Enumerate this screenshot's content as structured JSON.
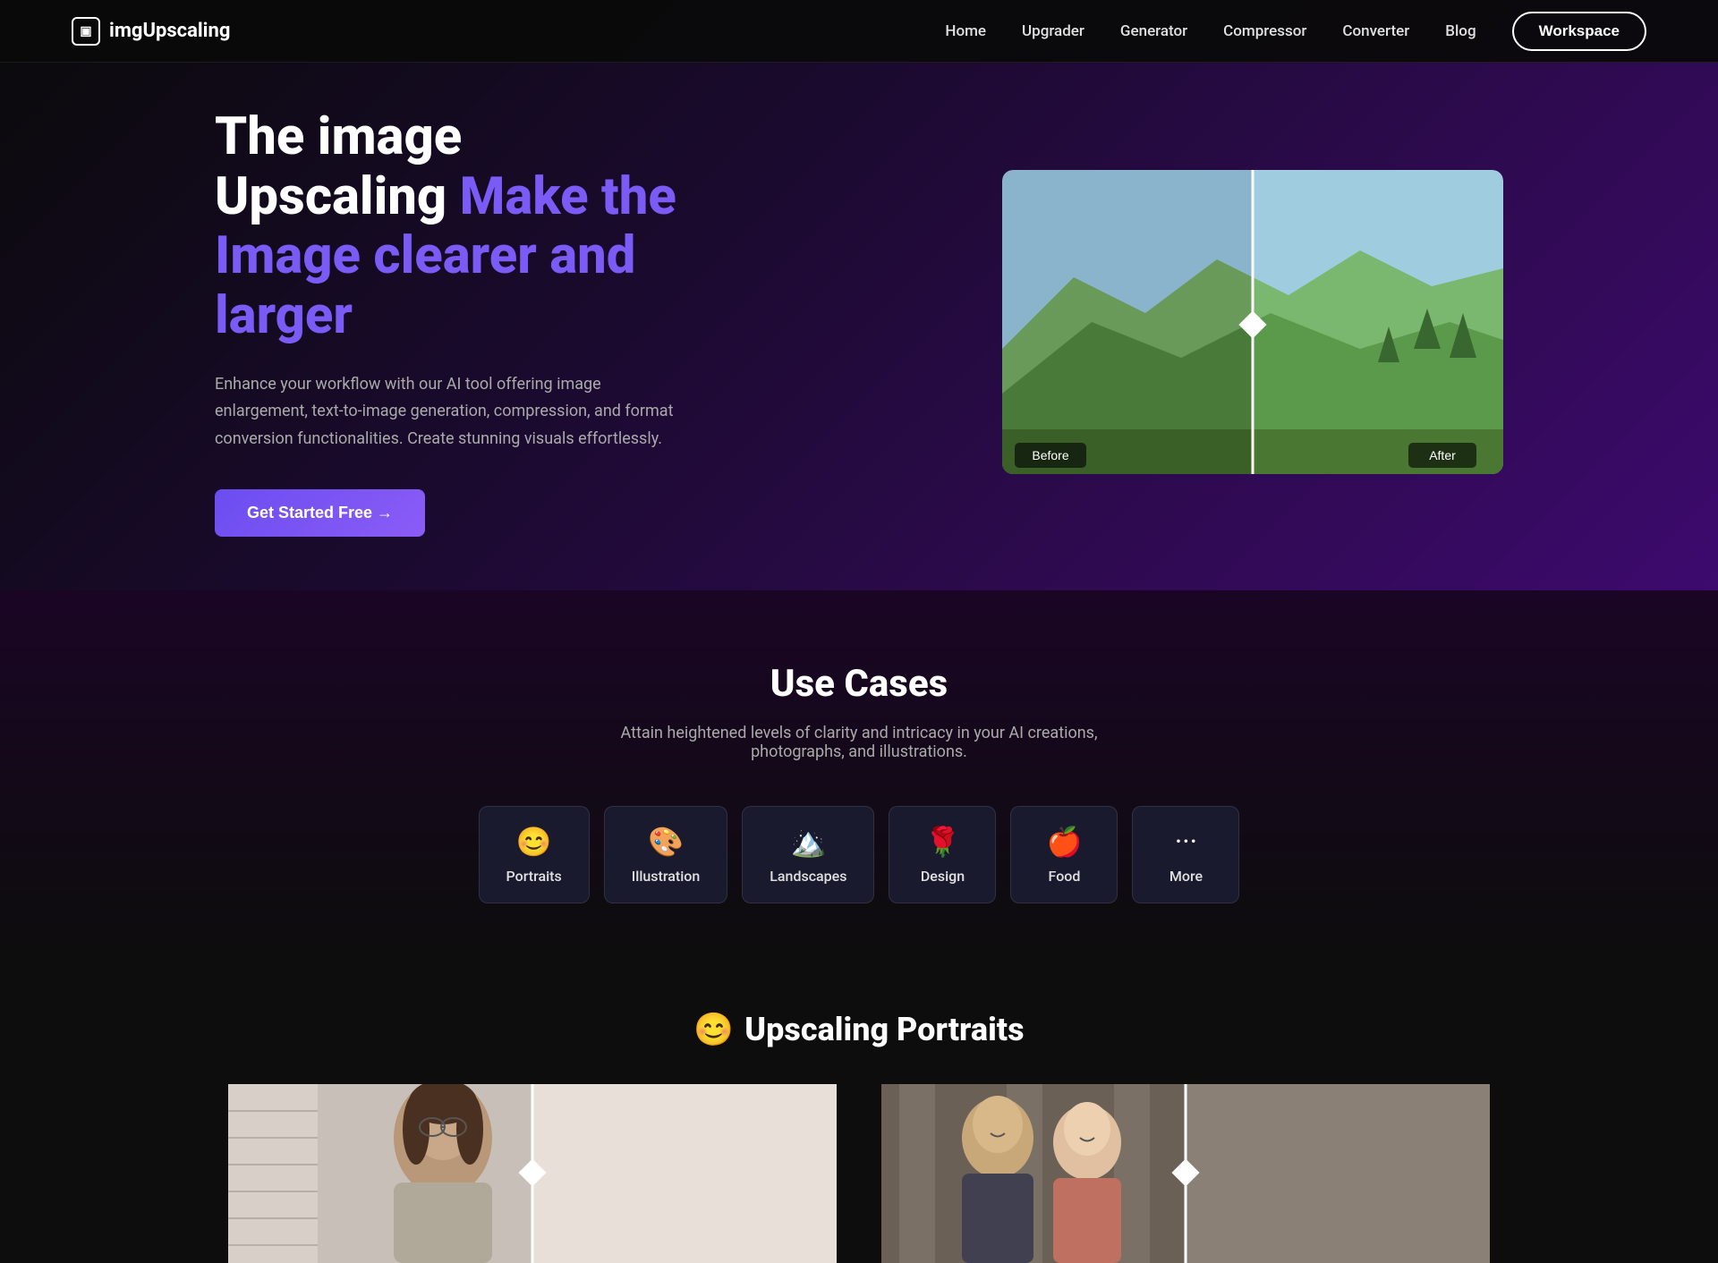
{
  "nav": {
    "logo_text": "imgUpscaling",
    "logo_icon": "▣",
    "links": [
      {
        "label": "Home",
        "name": "home"
      },
      {
        "label": "Upgrader",
        "name": "upgrader"
      },
      {
        "label": "Generator",
        "name": "generator"
      },
      {
        "label": "Compressor",
        "name": "compressor"
      },
      {
        "label": "Converter",
        "name": "converter"
      },
      {
        "label": "Blog",
        "name": "blog"
      }
    ],
    "workspace_btn": "Workspace"
  },
  "hero": {
    "title_part1": "The image Upscaling ",
    "title_highlight": "Make the Image clearer and larger",
    "subtitle": "Enhance your workflow with our AI tool offering image enlargement, text-to-image generation, compression, and format conversion functionalities. Create stunning visuals effortlessly.",
    "cta_label": "Get Started Free →",
    "before_label": "Before",
    "after_label": "After"
  },
  "use_cases": {
    "title": "Use Cases",
    "subtitle": "Attain heightened levels of clarity and intricacy in your AI creations, photographs, and illustrations.",
    "cards": [
      {
        "emoji": "😊",
        "label": "Portraits",
        "name": "portraits"
      },
      {
        "emoji": "🎨",
        "label": "Illustration",
        "name": "illustration"
      },
      {
        "emoji": "🏔️",
        "label": "Landscapes",
        "name": "landscapes"
      },
      {
        "emoji": "🌹",
        "label": "Design",
        "name": "design"
      },
      {
        "emoji": "🍎",
        "label": "Food",
        "name": "food"
      },
      {
        "emoji": "...",
        "label": "More",
        "name": "more"
      }
    ]
  },
  "portraits_section": {
    "emoji": "😊",
    "title": "Upscaling Portraits"
  }
}
